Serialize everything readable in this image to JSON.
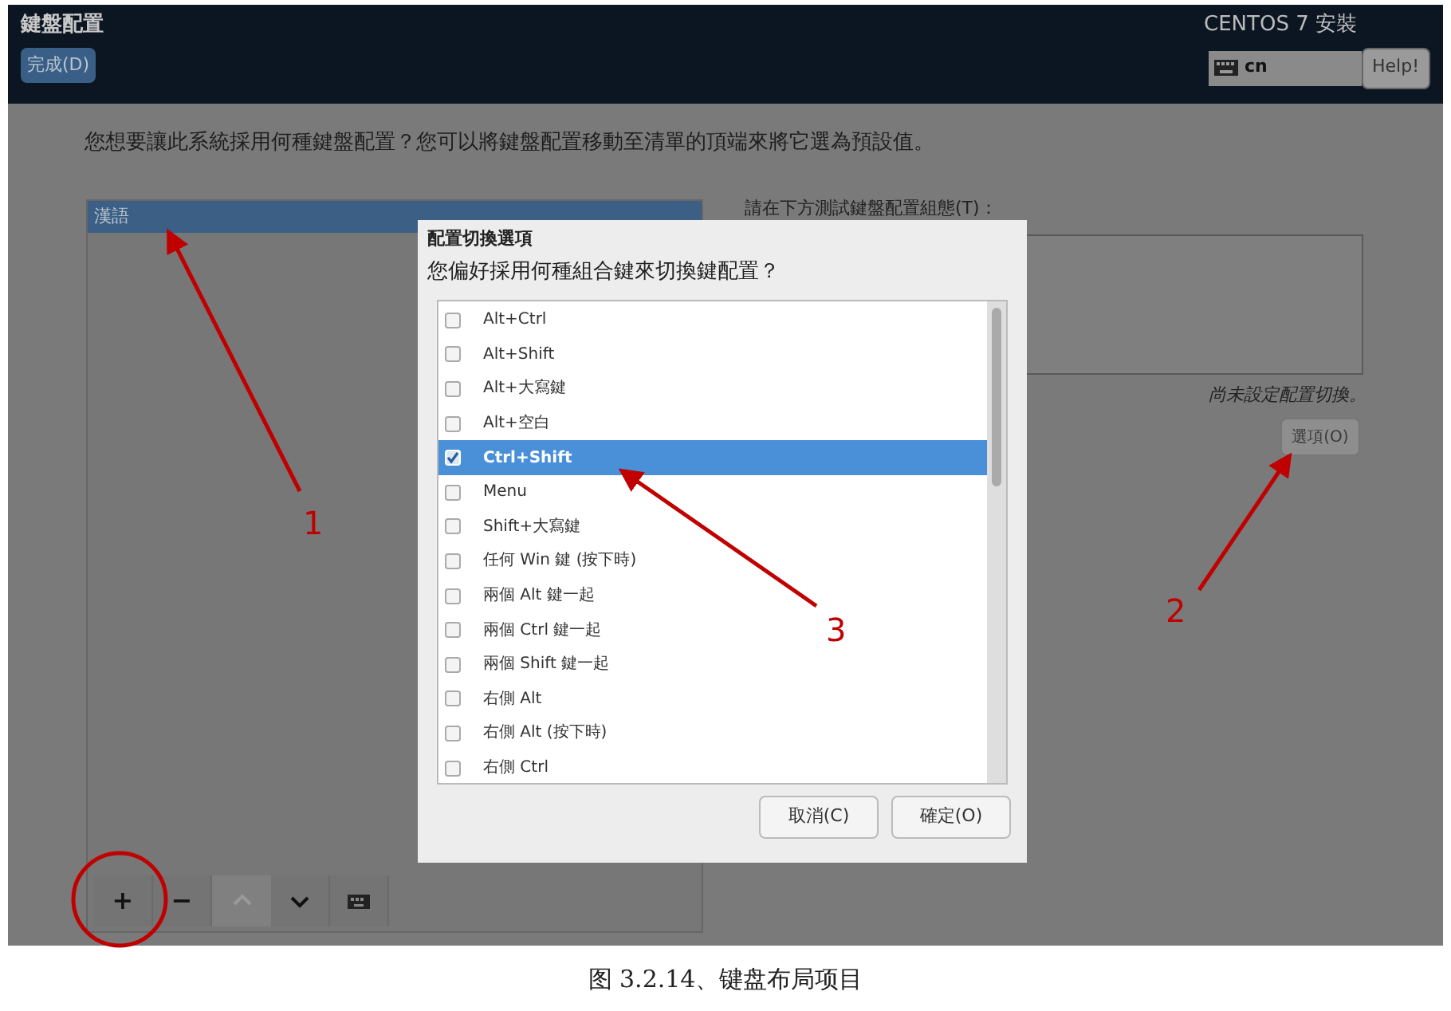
{
  "header": {
    "title": "鍵盤配置",
    "done_button": "完成(D)",
    "product": "CENTOS 7 安裝",
    "keyboard_indicator": "cn",
    "help_button": "Help!"
  },
  "prompt": "您想要讓此系統採用何種鍵盤配置？您可以將鍵盤配置移動至清單的頂端來將它選為預設值。",
  "layouts": [
    {
      "label": "漢語",
      "selected": true
    }
  ],
  "layout_toolbar": [
    {
      "kind": "add",
      "label": "+",
      "disabled": false
    },
    {
      "kind": "remove",
      "label": "−",
      "disabled": false
    },
    {
      "kind": "up",
      "disabled": true
    },
    {
      "kind": "down",
      "disabled": false
    },
    {
      "kind": "preview",
      "disabled": false
    }
  ],
  "test_label": "請在下方測試鍵盤配置組態(T)：",
  "switch_status": "尚未設定配置切換。",
  "options_button": "選項(O)",
  "dialog": {
    "title": "配置切換選項",
    "question": "您偏好採用何種組合鍵來切換鍵配置？",
    "options": [
      {
        "label": "Alt+Ctrl",
        "checked": false,
        "selected": false
      },
      {
        "label": "Alt+Shift",
        "checked": false,
        "selected": false
      },
      {
        "label": "Alt+大寫鍵",
        "checked": false,
        "selected": false
      },
      {
        "label": "Alt+空白",
        "checked": false,
        "selected": false
      },
      {
        "label": "Ctrl+Shift",
        "checked": true,
        "selected": true
      },
      {
        "label": "Menu",
        "checked": false,
        "selected": false
      },
      {
        "label": "Shift+大寫鍵",
        "checked": false,
        "selected": false
      },
      {
        "label": "任何 Win 鍵 (按下時)",
        "checked": false,
        "selected": false
      },
      {
        "label": "兩個 Alt 鍵一起",
        "checked": false,
        "selected": false
      },
      {
        "label": "兩個 Ctrl 鍵一起",
        "checked": false,
        "selected": false
      },
      {
        "label": "兩個 Shift 鍵一起",
        "checked": false,
        "selected": false
      },
      {
        "label": "右側 Alt",
        "checked": false,
        "selected": false
      },
      {
        "label": "右側 Alt (按下時)",
        "checked": false,
        "selected": false
      },
      {
        "label": "右側 Ctrl",
        "checked": false,
        "selected": false
      }
    ],
    "buttons": [
      "取消(C)",
      "確定(O)"
    ]
  },
  "annotations": [
    "1",
    "2",
    "3"
  ],
  "caption": "图 3.2.14、键盘布局项目"
}
